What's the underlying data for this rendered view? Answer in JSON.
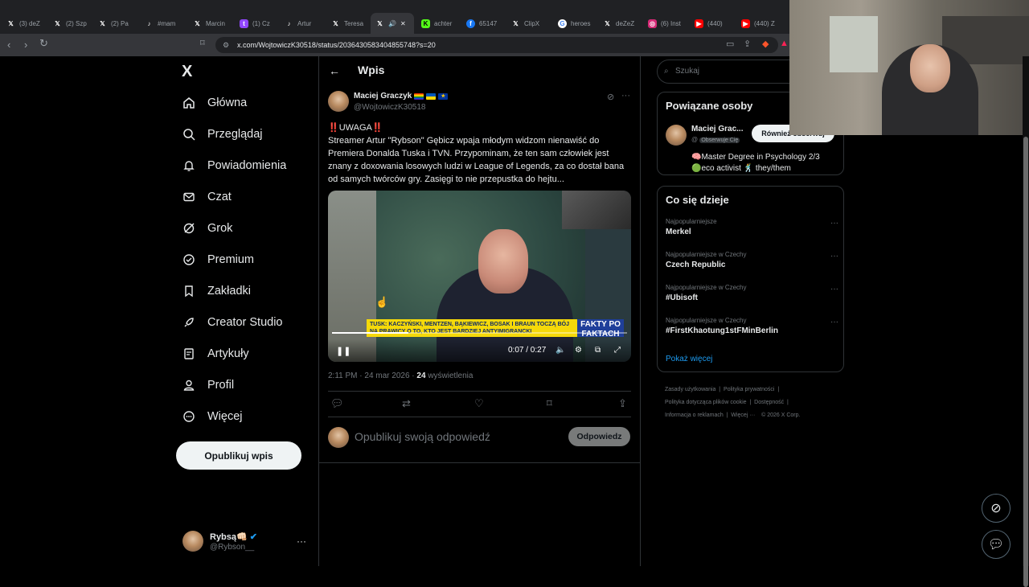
{
  "browser": {
    "tabs": [
      {
        "label": "(3) deZ",
        "icon": "X"
      },
      {
        "label": "(2) Szp",
        "icon": "X"
      },
      {
        "label": "(2) Pa",
        "icon": "X"
      },
      {
        "label": "#mam",
        "icon": "tiktok"
      },
      {
        "label": "Marcin",
        "icon": "X"
      },
      {
        "label": "(1) Cz",
        "icon": "twitch"
      },
      {
        "label": "Artur",
        "icon": "tiktok"
      },
      {
        "label": "Teresa",
        "icon": "X"
      },
      {
        "label": "",
        "icon": "X",
        "active": true
      },
      {
        "label": "achter",
        "icon": "kick"
      },
      {
        "label": "65147",
        "icon": "facebook"
      },
      {
        "label": "ClipX",
        "icon": "X"
      },
      {
        "label": "heroes",
        "icon": "google"
      },
      {
        "label": "deZeZ",
        "icon": "X"
      },
      {
        "label": "(6) Inst",
        "icon": "instagram"
      },
      {
        "label": "(440)",
        "icon": "youtube"
      },
      {
        "label": "(440) Z",
        "icon": "youtube"
      }
    ],
    "url": "x.com/WojtowiczK30518/status/2036430583404855748?s=20"
  },
  "sidebar": {
    "logo": "X",
    "items": [
      {
        "label": "Główna",
        "icon": "home-icon"
      },
      {
        "label": "Przeglądaj",
        "icon": "search-icon"
      },
      {
        "label": "Powiadomienia",
        "icon": "bell-icon"
      },
      {
        "label": "Czat",
        "icon": "mail-icon"
      },
      {
        "label": "Grok",
        "icon": "grok-icon"
      },
      {
        "label": "Premium",
        "icon": "premium-icon"
      },
      {
        "label": "Zakładki",
        "icon": "bookmark-icon"
      },
      {
        "label": "Creator Studio",
        "icon": "rocket-icon"
      },
      {
        "label": "Artykuły",
        "icon": "article-icon"
      },
      {
        "label": "Profil",
        "icon": "person-icon"
      },
      {
        "label": "Więcej",
        "icon": "more-circle-icon"
      }
    ],
    "post_button": "Opublikuj wpis",
    "account": {
      "name": "Rybsą👊🏻",
      "handle": "@Rybson__"
    }
  },
  "main": {
    "header_title": "Wpis",
    "tweet": {
      "author_name": "Maciej Graczyk",
      "author_handle": "@WojtowiczK30518",
      "text_lead": "UWAGA",
      "text_body": "Streamer Artur \"Rybson\" Gębicz wpaja młodym widzom nienawiść do Premiera Donalda Tuska i TVN. Przypominam, że ten sam człowiek jest znany z doxowania losowych ludzi w League of Legends, za co dostał bana od samych twórców gry. Zasięgi to nie przepustka do hejtu...",
      "video": {
        "ticker": "TUSK: KACZYŃSKI, MENTZEN, BĄKIEWICZ, BOSAK I BRAUN TOCZĄ BÓJ NA PRAWICY O TO, KTO JEST BARDZIEJ ANTYIMIGRANCKI",
        "brand": "FAKTY PO FAKTACH",
        "time": "0:07 / 0:27",
        "progress": 0.26
      },
      "meta_time": "2:11 PM · 24 mar 2026 · ",
      "views": "24",
      "views_label": " wyświetlenia"
    },
    "reply_placeholder": "Opublikuj swoją odpowiedź",
    "reply_button": "Odpowiedz"
  },
  "right": {
    "search_placeholder": "Szukaj",
    "related_title": "Powiązane osoby",
    "related": {
      "name": "Maciej Grac...",
      "handle_prefix": "@",
      "follows_badge": "Obserwuje Cię",
      "follow_button": "Również obserwuj",
      "bio_line1": "🧠Master Degree in Psychology 2/3",
      "bio_line2": "🟢eco activist 🕺 they/them"
    },
    "trends_title": "Co się dzieje",
    "trends": [
      {
        "context": "Najpopularniejsze",
        "title": "Merkel"
      },
      {
        "context": "Najpopularniejsze w Czechy",
        "title": "Czech Republic"
      },
      {
        "context": "Najpopularniejsze w Czechy",
        "title": "#Ubisoft"
      },
      {
        "context": "Najpopularniejsze w Czechy",
        "title": "#FirstKhaotung1stFMinBerlin"
      }
    ],
    "show_more": "Pokaż więcej",
    "footer": [
      "Zasady użytkowania",
      "Polityka prywatności",
      "Polityka dotycząca plików cookie",
      "Dostępność",
      "Informacja o reklamach",
      "Więcej ···",
      "© 2026 X Corp."
    ]
  },
  "colors": {
    "accent": "#1d9bf0",
    "background": "#000000",
    "border": "#2f3336",
    "muted": "#71767b",
    "alert": "#f4212e"
  }
}
